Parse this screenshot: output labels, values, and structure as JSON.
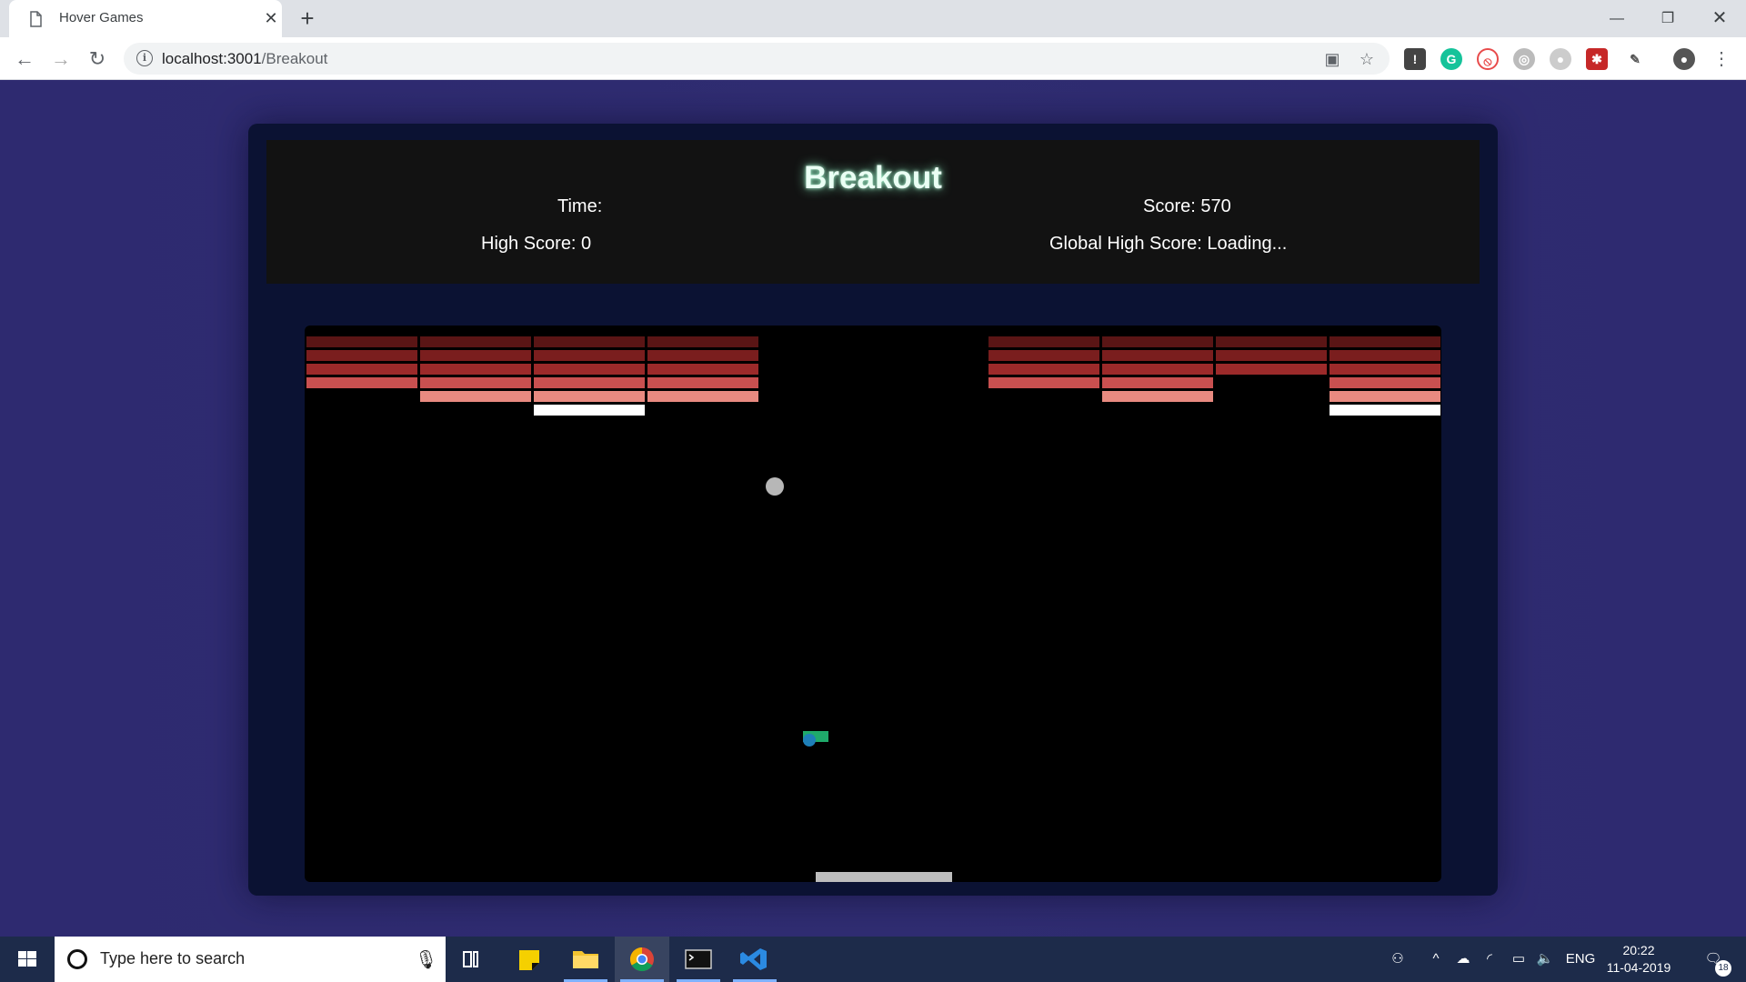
{
  "browser": {
    "tab_title": "Hover Games",
    "url_host": "localhost:3001",
    "url_path": "/Breakout"
  },
  "game": {
    "title": "Breakout",
    "time_label": "Time:",
    "score_label": "Score: 570",
    "high_score_label": "High Score: 0",
    "global_high_score_label": "Global High Score: Loading...",
    "brick_colors": [
      "#5a1515",
      "#7a1e1e",
      "#9c2a2a",
      "#c95050",
      "#e88a80",
      "#ffffff"
    ],
    "bricks": [
      {
        "col": 0,
        "row": 0
      },
      {
        "col": 0,
        "row": 1
      },
      {
        "col": 0,
        "row": 2
      },
      {
        "col": 0,
        "row": 3
      },
      {
        "col": 1,
        "row": 0
      },
      {
        "col": 1,
        "row": 1
      },
      {
        "col": 1,
        "row": 2
      },
      {
        "col": 1,
        "row": 3
      },
      {
        "col": 1,
        "row": 4
      },
      {
        "col": 2,
        "row": 0
      },
      {
        "col": 2,
        "row": 1
      },
      {
        "col": 2,
        "row": 2
      },
      {
        "col": 2,
        "row": 3
      },
      {
        "col": 2,
        "row": 4
      },
      {
        "col": 2,
        "row": 5
      },
      {
        "col": 3,
        "row": 0
      },
      {
        "col": 3,
        "row": 1
      },
      {
        "col": 3,
        "row": 2
      },
      {
        "col": 3,
        "row": 3
      },
      {
        "col": 3,
        "row": 4
      },
      {
        "col": 6,
        "row": 0
      },
      {
        "col": 6,
        "row": 1
      },
      {
        "col": 6,
        "row": 2
      },
      {
        "col": 6,
        "row": 3
      },
      {
        "col": 7,
        "row": 0
      },
      {
        "col": 7,
        "row": 1
      },
      {
        "col": 7,
        "row": 2
      },
      {
        "col": 7,
        "row": 3
      },
      {
        "col": 7,
        "row": 4
      },
      {
        "col": 8,
        "row": 0
      },
      {
        "col": 8,
        "row": 1
      },
      {
        "col": 8,
        "row": 2
      },
      {
        "col": 9,
        "row": 0
      },
      {
        "col": 9,
        "row": 1
      },
      {
        "col": 9,
        "row": 2
      },
      {
        "col": 9,
        "row": 3
      },
      {
        "col": 9,
        "row": 4
      },
      {
        "col": 9,
        "row": 5
      }
    ]
  },
  "taskbar": {
    "search_placeholder": "Type here to search",
    "lang": "ENG",
    "time": "20:22",
    "date": "11-04-2019",
    "notifications": "18"
  }
}
